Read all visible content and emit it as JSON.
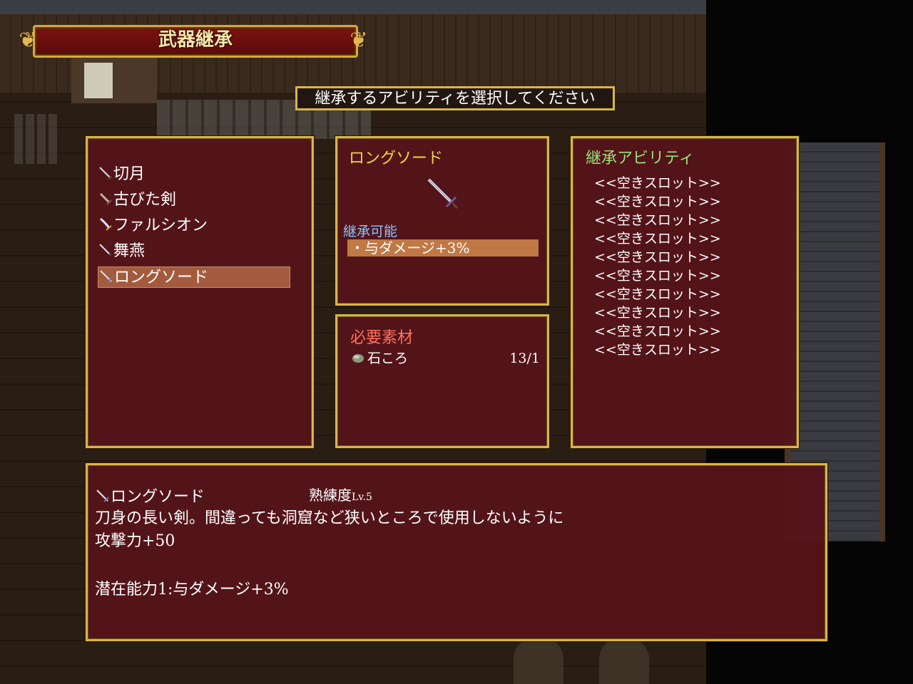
{
  "title": "武器継承",
  "prompt": "継承するアビリティを選択してください",
  "weapon_list": {
    "items": [
      {
        "label": "切月"
      },
      {
        "label": "古びた剣"
      },
      {
        "label": "ファルシオン"
      },
      {
        "label": "舞燕"
      },
      {
        "label": "ロングソード",
        "selected": true
      }
    ]
  },
  "weapon_panel": {
    "name": "ロングソード",
    "inheritable_label": "継承可能",
    "inheritable_ability": "・与ダメージ+3%"
  },
  "materials_panel": {
    "header": "必要素材",
    "items": [
      {
        "name": "石ころ",
        "count": "13/1"
      }
    ]
  },
  "ability_panel": {
    "header": "継承アビリティ",
    "slots": [
      "<<空きスロット>>",
      "<<空きスロット>>",
      "<<空きスロット>>",
      "<<空きスロット>>",
      "<<空きスロット>>",
      "<<空きスロット>>",
      "<<空きスロット>>",
      "<<空きスロット>>",
      "<<空きスロット>>",
      "<<空きスロット>>"
    ]
  },
  "description": {
    "name": "ロングソード",
    "proficiency_label": "熟練度",
    "proficiency_level": "Lv.5",
    "text": "刀身の長い剣。間違っても洞窟など狭いところで使用しないように",
    "stat": "攻撃力+50",
    "potential": "潜在能力1:与ダメージ+3%"
  },
  "colors": {
    "window_bg": "#56141a",
    "border_gold": "#d9b548",
    "highlight": "#a45b3d",
    "name_gold": "#f1d34b",
    "info_blue": "#86c4ff",
    "header_green": "#9de07a",
    "header_red": "#ff7060"
  }
}
